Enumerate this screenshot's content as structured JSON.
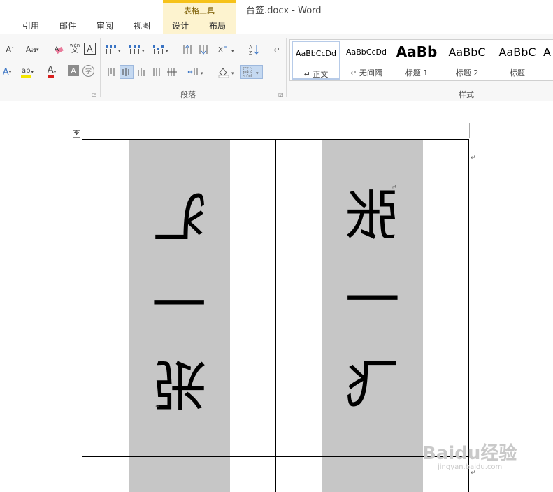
{
  "window": {
    "doc_title": "台签.docx - Word",
    "contextual_group": "表格工具"
  },
  "tabs": [
    {
      "label": "引用"
    },
    {
      "label": "邮件"
    },
    {
      "label": "审阅"
    },
    {
      "label": "视图"
    },
    {
      "label": "设计"
    },
    {
      "label": "布局"
    }
  ],
  "ribbon": {
    "font_group": {
      "grow_font": "A",
      "change_case": "Aa",
      "phonetic_top": "wén",
      "phonetic_bottom": "文",
      "char_border": "A",
      "text_effects": "A",
      "highlight": "ab",
      "font_color": "A",
      "char_shading": "A",
      "enclose": "字"
    },
    "paragraph_group": {
      "label": "段落"
    },
    "styles_group": {
      "label": "样式",
      "items": [
        {
          "sample": "AaBbCcDd",
          "name": "正文",
          "prefix": "↵"
        },
        {
          "sample": "AaBbCcDd",
          "name": "无间隔",
          "prefix": "↵"
        },
        {
          "sample": "AaBb",
          "name": "标题 1",
          "prefix": ""
        },
        {
          "sample": "AaBbC",
          "name": "标题 2",
          "prefix": ""
        },
        {
          "sample": "AaBbC",
          "name": "标题",
          "prefix": ""
        },
        {
          "sample": "A",
          "name": "",
          "prefix": ""
        }
      ]
    }
  },
  "document": {
    "left_card_text": "张一飞",
    "right_card_text": "张一飞",
    "paragraph_mark": "↵",
    "cell_end_mark": "↵"
  },
  "watermark": {
    "main": "Baidu经验",
    "sub": "jingyan.baidu.com"
  },
  "colors": {
    "contextual_accent": "#f6c21a",
    "shading": "#c6c6c6",
    "active_button": "#c5d9f1"
  }
}
